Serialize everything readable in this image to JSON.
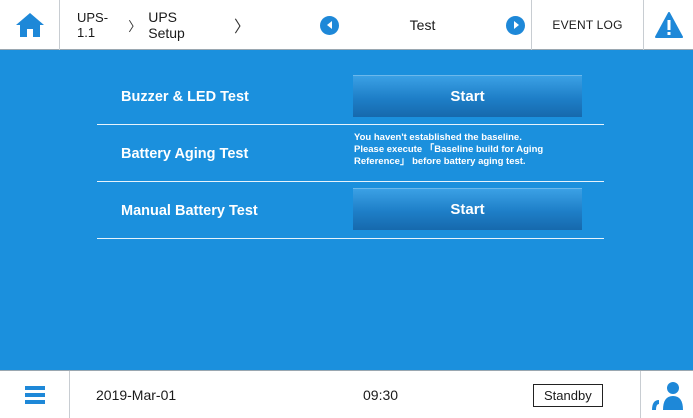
{
  "header": {
    "breadcrumb": {
      "device": "UPS-1.1",
      "device_sep": "〉",
      "section": "UPS Setup",
      "section_sep": "〉"
    },
    "page_title": "Test",
    "event_log_label": "EVENT LOG"
  },
  "tests": [
    {
      "label": "Buzzer & LED Test",
      "button_label": "Start"
    },
    {
      "label": "Battery Aging Test",
      "message_lines": [
        "You haven't established the baseline.",
        "Please execute 「Baseline build for Aging",
        "Reference」 before battery aging test."
      ]
    },
    {
      "label": "Manual Battery Test",
      "button_label": "Start"
    }
  ],
  "footer": {
    "date": "2019-Mar-01",
    "time": "09:30",
    "status": "Standby"
  },
  "colors": {
    "panel_bg": "#1b90dd",
    "nav_arrow": "#1e88d8",
    "home_icon": "#1e88d8",
    "warning_icon": "#1e88d8"
  },
  "icons": {
    "home": "home-icon",
    "prev": "chevron-left-icon",
    "next": "chevron-right-icon",
    "warning": "warning-icon",
    "menu": "menu-icon",
    "user": "user-icon"
  }
}
